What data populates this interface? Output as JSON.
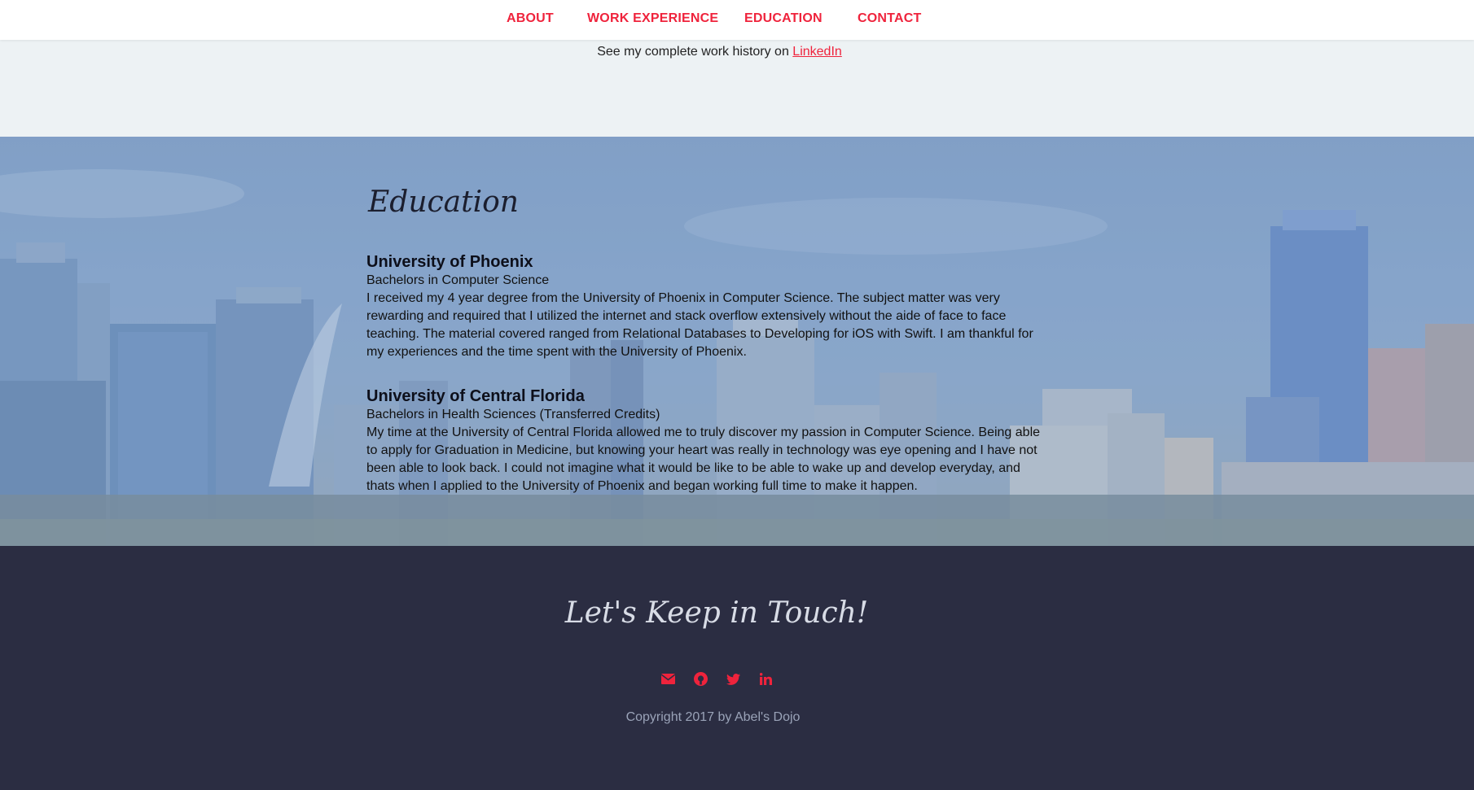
{
  "nav": {
    "items": [
      {
        "label": "ABOUT"
      },
      {
        "label": "WORK EXPERIENCE"
      },
      {
        "label": "EDUCATION"
      },
      {
        "label": "CONTACT"
      }
    ]
  },
  "work": {
    "history_prefix": "See my complete work history on ",
    "linkedin_link": "LinkedIn"
  },
  "education": {
    "title": "Education",
    "schools": [
      {
        "name": "University of Phoenix",
        "degree": "Bachelors in Computer Science",
        "description": "I received my 4 year degree from the University of Phoenix in Computer Science. The subject matter was very rewarding and required that I utilized the internet and stack overflow extensively without the aide of face to face teaching. The material covered ranged from Relational Databases to Developing for iOS with Swift. I am thankful for my experiences and the time spent with the University of Phoenix."
      },
      {
        "name": "University of Central Florida",
        "degree": "Bachelors in Health Sciences (Transferred Credits)",
        "description": "My time at the University of Central Florida allowed me to truly discover my passion in Computer Science. Being able to apply for Graduation in Medicine, but knowing your heart was really in technology was eye opening and I have not been able to look back. I could not imagine what it would be like to be able to wake up and develop everyday, and thats when I applied to the University of Phoenix and began working full time to make it happen."
      }
    ]
  },
  "footer": {
    "title": "Let's Keep in Touch!",
    "social_icons": [
      "envelope-icon",
      "github-icon",
      "twitter-icon",
      "linkedin-icon"
    ],
    "copyright": "Copyright 2017 by Abel's Dojo"
  },
  "colors": {
    "accent": "#ef233c",
    "nav_bg": "#ffffff",
    "work_bg": "#edf2f4",
    "footer_bg": "#2b2d42"
  }
}
